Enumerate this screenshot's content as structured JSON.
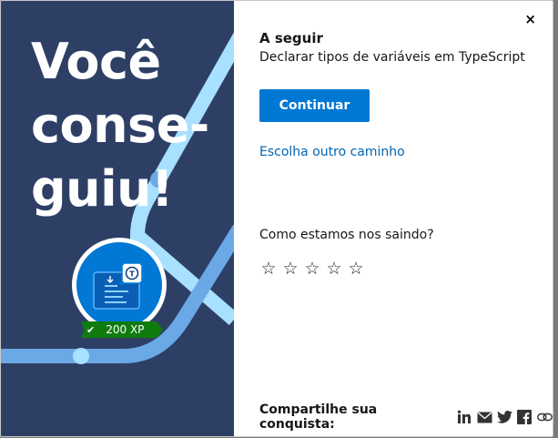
{
  "background": {
    "fragments": [
      "o",
      "u",
      "o",
      "o",
      "o",
      "o"
    ]
  },
  "hero": {
    "title_lines": [
      "Você",
      "conse-",
      "guiu!"
    ],
    "xp": "200 XP",
    "badge_icon": "typescript-module-icon",
    "colors": {
      "bg": "#2e3f66",
      "track_light": "#a8e0ff",
      "track_mid": "#6aa9e6",
      "badge": "#0078d4",
      "xp_bg": "#107c10"
    }
  },
  "panel": {
    "close_label": "×",
    "next_label": "A seguir",
    "next_title": "Declarar tipos de variáveis em TypeScript",
    "continue_label": "Continuar",
    "other_path_label": "Escolha outro caminho",
    "feedback_question": "Como estamos nos saindo?",
    "stars": [
      "☆",
      "☆",
      "☆",
      "☆",
      "☆"
    ],
    "share_label": "Compartilhe sua conquista:",
    "share_icons": [
      "linkedin-icon",
      "email-icon",
      "twitter-icon",
      "facebook-icon",
      "copy-link-icon"
    ]
  }
}
